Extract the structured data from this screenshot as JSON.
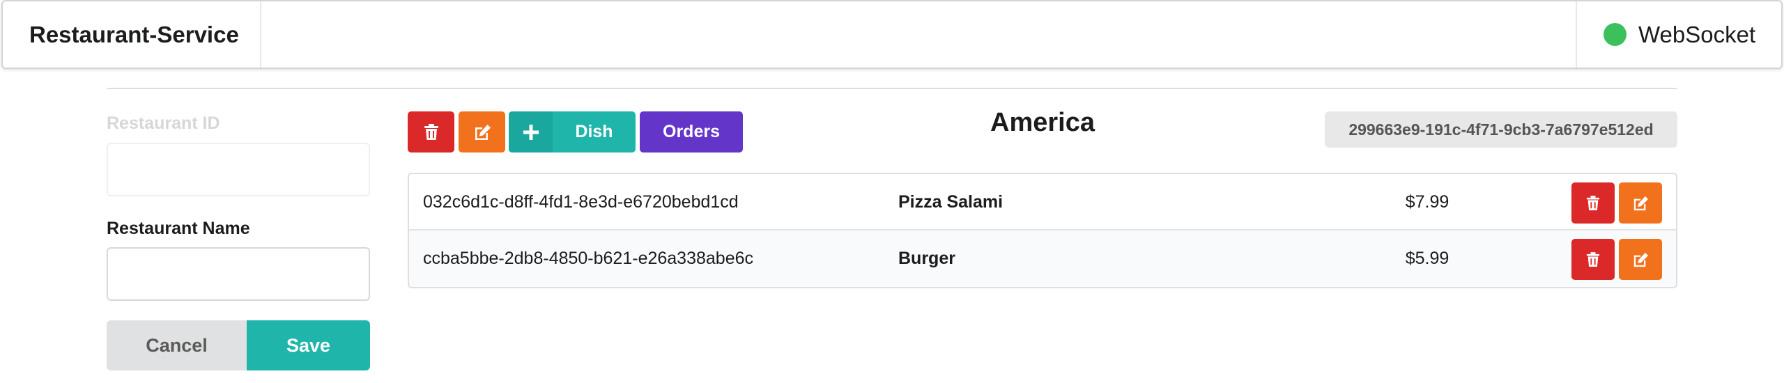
{
  "app": {
    "title": "Restaurant-Service",
    "connection": {
      "label": "WebSocket",
      "status_color": "#3cc05c"
    }
  },
  "form": {
    "restaurant_id_label": "Restaurant ID",
    "restaurant_id_value": "",
    "restaurant_name_label": "Restaurant Name",
    "restaurant_name_value": "",
    "cancel_label": "Cancel",
    "save_label": "Save"
  },
  "toolbar": {
    "delete_icon": "trash-icon",
    "edit_icon": "edit-icon",
    "add_icon": "plus-icon",
    "dish_label": "Dish",
    "orders_label": "Orders"
  },
  "restaurant": {
    "name": "America",
    "id": "299663e9-191c-4f71-9cb3-7a6797e512ed"
  },
  "dishes": [
    {
      "id": "032c6d1c-d8ff-4fd1-8e3d-e6720bebd1cd",
      "name": "Pizza Salami",
      "price": "$7.99"
    },
    {
      "id": "ccba5bbe-2db8-4850-b621-e26a338abe6c",
      "name": "Burger",
      "price": "$5.99"
    }
  ],
  "colors": {
    "delete": "#db2828",
    "edit": "#f2711c",
    "primary": "#1fb5ab",
    "orders": "#6435c9"
  }
}
